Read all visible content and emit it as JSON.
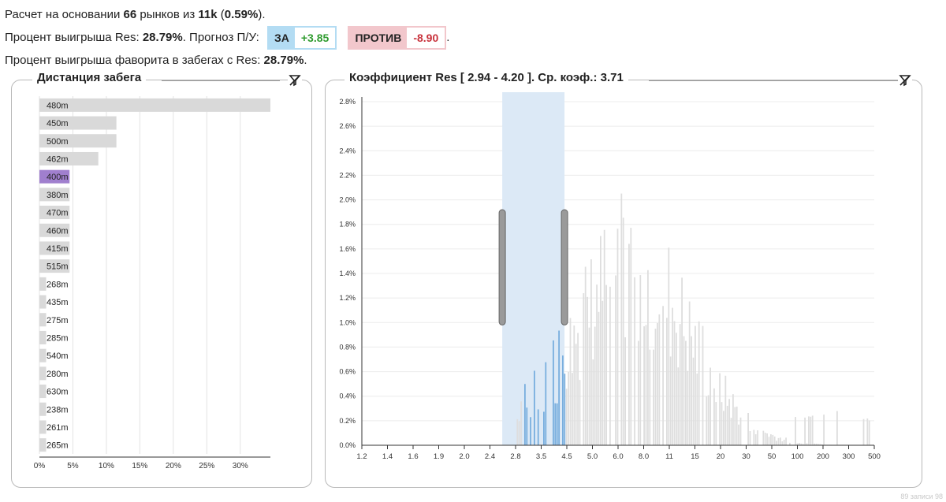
{
  "summary": {
    "line1_prefix": "Расчет на основании ",
    "markets": "66",
    "line1_mid": " рынков из ",
    "total": "11k",
    "line1_paren_open": " (",
    "percent": "0.59%",
    "line1_paren_close": ").",
    "line2_prefix": "Процент выигрыша Res: ",
    "winrate": "28.79%",
    "line2_mid": ". Прогноз П/У:",
    "za_label": "ЗА",
    "za_value": "+3.85",
    "protiv_label": "ПРОТИВ",
    "protiv_value": "-8.90",
    "line2_end": ".",
    "line3_prefix": "Процент выигрыша фаворита в забегах с Res: ",
    "fav_winrate": "28.79%",
    "line3_end": "."
  },
  "colors": {
    "za_bg": "#b3dcf3",
    "za_value": "#2e9b2e",
    "protiv_bg": "#f2c7cc",
    "protiv_value": "#c8313b",
    "bar_default": "#d9d9d9",
    "bar_highlight": "#a07fce",
    "hist_selected": "#78aede",
    "hist_default": "#dedede",
    "brush": "#dce9f6"
  },
  "distance_panel": {
    "title": "Дистанция забега",
    "filter_icon": "filter-clear-icon"
  },
  "odds_panel": {
    "title": "Коэффициент Res [ 2.94 - 4.20 ]. Ср. коэф.: 3.71",
    "filter_icon": "filter-clear-icon"
  },
  "chart_data": [
    {
      "type": "bar",
      "orientation": "horizontal",
      "categories": [
        "480m",
        "450m",
        "500m",
        "462m",
        "400m",
        "380m",
        "470m",
        "460m",
        "415m",
        "515m",
        "268m",
        "435m",
        "275m",
        "285m",
        "540m",
        "280m",
        "630m",
        "238m",
        "261m",
        "265m"
      ],
      "values": [
        34.5,
        11.5,
        11.5,
        8.8,
        4.5,
        4.5,
        4.5,
        4.5,
        4.5,
        4.5,
        1.0,
        1.0,
        1.0,
        1.0,
        1.0,
        1.0,
        1.0,
        1.0,
        1.0,
        1.0
      ],
      "highlighted": "400m",
      "x_ticks": [
        "0%",
        "5%",
        "10%",
        "15%",
        "20%",
        "25%",
        "30%"
      ],
      "xlim": [
        0,
        34.5
      ],
      "grid": true
    },
    {
      "type": "bar",
      "title": "Коэффициент Res [ 2.94 - 4.20 ]. Ср. коэф.: 3.71",
      "x_scale": "log",
      "x_ticks": [
        "1.2",
        "1.4",
        "1.6",
        "1.9",
        "2.0",
        "2.4",
        "2.8",
        "3.5",
        "4.5",
        "5.0",
        "6.0",
        "8.0",
        "11",
        "15",
        "20",
        "30",
        "50",
        "100",
        "200",
        "300",
        "500"
      ],
      "y_ticks": [
        "0.0%",
        "0.2%",
        "0.4%",
        "0.6%",
        "0.8%",
        "1.0%",
        "1.2%",
        "1.4%",
        "1.6%",
        "1.8%",
        "2.0%",
        "2.2%",
        "2.4%",
        "2.6%",
        "2.8%"
      ],
      "ylim": [
        0,
        2.8
      ],
      "selection": [
        2.94,
        4.2
      ],
      "grid": true
    }
  ],
  "footer": {
    "note": "89 записи 98"
  }
}
